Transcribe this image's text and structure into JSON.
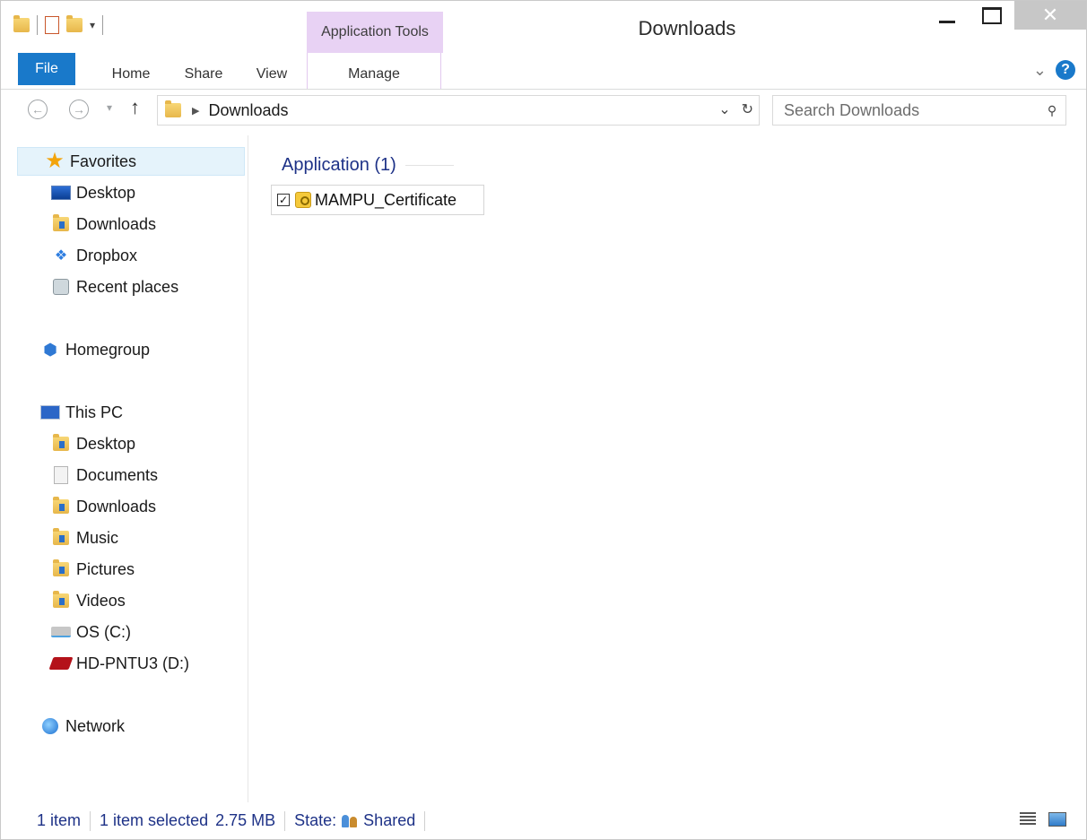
{
  "window": {
    "title": "Downloads",
    "close_glyph": "✕"
  },
  "ribbon": {
    "context_group_label": "Application Tools",
    "tabs": {
      "file": "File",
      "home": "Home",
      "share": "Share",
      "view": "View",
      "manage": "Manage"
    },
    "help_glyph": "?"
  },
  "address": {
    "crumb": "Downloads",
    "dropdown_glyph": "⌄",
    "refresh_glyph": "↻"
  },
  "search": {
    "placeholder": "Search Downloads"
  },
  "navpane": {
    "favorites": "Favorites",
    "favorites_items": [
      "Desktop",
      "Downloads",
      "Dropbox",
      "Recent places"
    ],
    "homegroup": "Homegroup",
    "this_pc": "This PC",
    "this_pc_items": [
      "Desktop",
      "Documents",
      "Downloads",
      "Music",
      "Pictures",
      "Videos",
      "OS (C:)",
      "HD-PNTU3 (D:)"
    ],
    "network": "Network"
  },
  "content": {
    "group_header": "Application (1)",
    "files": [
      {
        "name": "MAMPU_Certificate",
        "checked": true
      }
    ]
  },
  "status": {
    "item_count": "1 item",
    "selected": "1 item selected",
    "size": "2.75 MB",
    "state_label": "State:",
    "state_value": "Shared"
  },
  "icons": {
    "favorites": "star-icon",
    "desktop": "monitor-icon",
    "downloads": "downloads-folder-icon",
    "dropbox": "dropbox-icon",
    "recent": "recent-places-icon",
    "homegroup": "homegroup-icon",
    "this_pc": "computer-icon",
    "network": "network-icon"
  },
  "colors": {
    "accent": "#1979ca",
    "context_tab": "#e8d2f4",
    "status_text": "#1e3287"
  }
}
